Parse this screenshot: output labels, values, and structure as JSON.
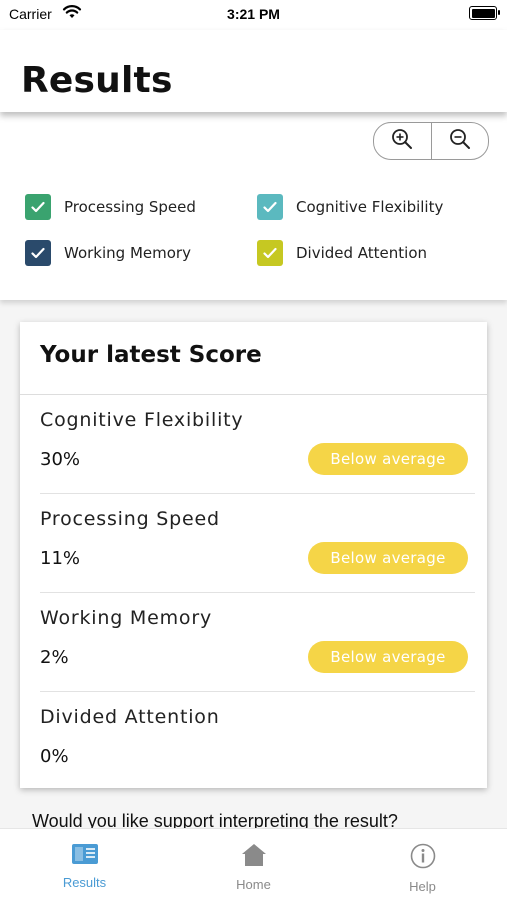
{
  "status_bar": {
    "carrier": "Carrier",
    "time": "3:21 PM",
    "wifi_icon": "wifi-icon",
    "battery_icon": "battery-icon"
  },
  "header": {
    "title": "Results"
  },
  "zoom": {
    "zoom_in_icon": "zoom-in-icon",
    "zoom_out_icon": "zoom-out-icon"
  },
  "legend": [
    {
      "label": "Processing Speed",
      "color": "#3aa36f",
      "checked": true
    },
    {
      "label": "Cognitive Flexibility",
      "color": "#5bb9bf",
      "checked": true
    },
    {
      "label": "Working Memory",
      "color": "#2a4a6b",
      "checked": true
    },
    {
      "label": "Divided Attention",
      "color": "#c6c822",
      "checked": true
    }
  ],
  "score_card": {
    "title": "Your latest Score",
    "rows": [
      {
        "name": "Cognitive Flexibility",
        "value": "30%",
        "badge": "Below average"
      },
      {
        "name": "Processing Speed",
        "value": "11%",
        "badge": "Below average"
      },
      {
        "name": "Working Memory",
        "value": "2%",
        "badge": "Below average"
      },
      {
        "name": "Divided Attention",
        "value": "0%",
        "badge": ""
      }
    ]
  },
  "support_text": "Would you like support interpreting the result?",
  "tabbar": {
    "tabs": [
      {
        "label": "Results",
        "icon": "book-icon",
        "active": true,
        "color": "#4a9bd4"
      },
      {
        "label": "Home",
        "icon": "home-icon",
        "active": false,
        "color": "#8a8a8a"
      },
      {
        "label": "Help",
        "icon": "info-icon",
        "active": false,
        "color": "#8a8a8a"
      }
    ]
  },
  "colors": {
    "badge_yellow": "#f5d547",
    "active_tab": "#4a9bd4"
  }
}
